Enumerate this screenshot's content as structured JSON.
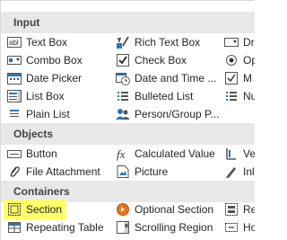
{
  "sections": {
    "input": "Input",
    "objects": "Objects",
    "containers": "Containers"
  },
  "input": {
    "col1": [
      "Text Box",
      "Combo Box",
      "Date Picker",
      "List Box",
      "Plain List"
    ],
    "col2": [
      "Rich Text Box",
      "Check Box",
      "Date and Time ...",
      "Bulleted List",
      "Person/Group P..."
    ],
    "col3": [
      "Dr",
      "Op",
      "M",
      "Nu"
    ]
  },
  "objects": {
    "col1": [
      "Button",
      "File Attachment"
    ],
    "col2": [
      "Calculated Value",
      "Picture"
    ],
    "col3": [
      "Ve",
      "Inl"
    ]
  },
  "containers": {
    "col1": [
      "Section",
      "Repeating Table"
    ],
    "col2": [
      "Optional Section",
      "Scrolling Region"
    ],
    "col3": [
      "Re",
      "Ho"
    ]
  },
  "highlight_color": "#ffff66",
  "accent_color": "#2e75b6"
}
